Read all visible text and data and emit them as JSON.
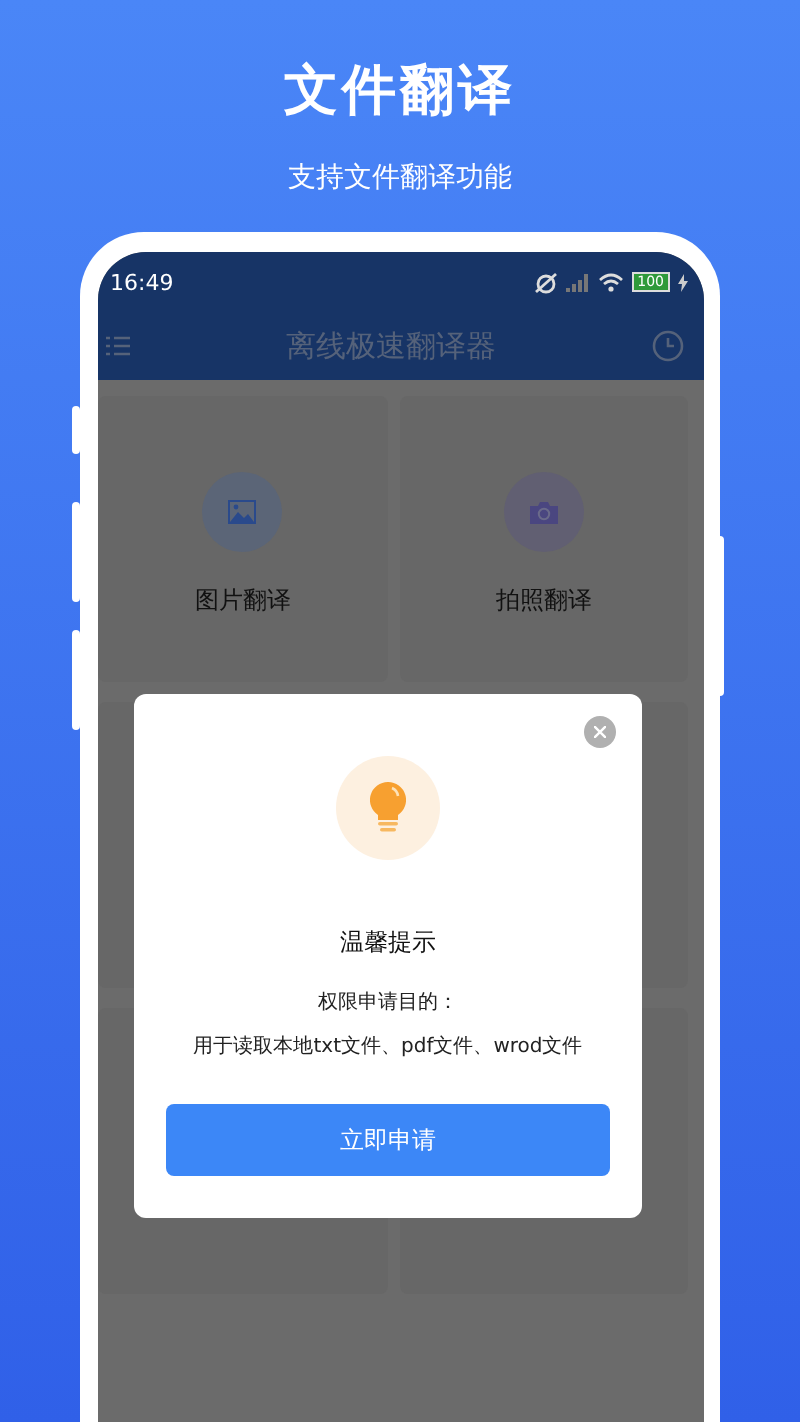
{
  "header": {
    "title": "文件翻译",
    "subtitle": "支持文件翻译功能"
  },
  "status_bar": {
    "time": "16:49",
    "battery": "100"
  },
  "app_bar": {
    "title": "离线极速翻译器"
  },
  "features": [
    {
      "kind": "image",
      "label": "图片翻译"
    },
    {
      "kind": "camera",
      "label": "拍照翻译"
    },
    {
      "kind": "blank"
    },
    {
      "kind": "blank"
    },
    {
      "kind": "blank"
    },
    {
      "kind": "blank"
    }
  ],
  "dialog": {
    "title": "温馨提示",
    "purpose_label": "权限申请目的：",
    "purpose": "用于读取本地txt文件、pdf文件、wrod文件",
    "button": "立即申请"
  }
}
